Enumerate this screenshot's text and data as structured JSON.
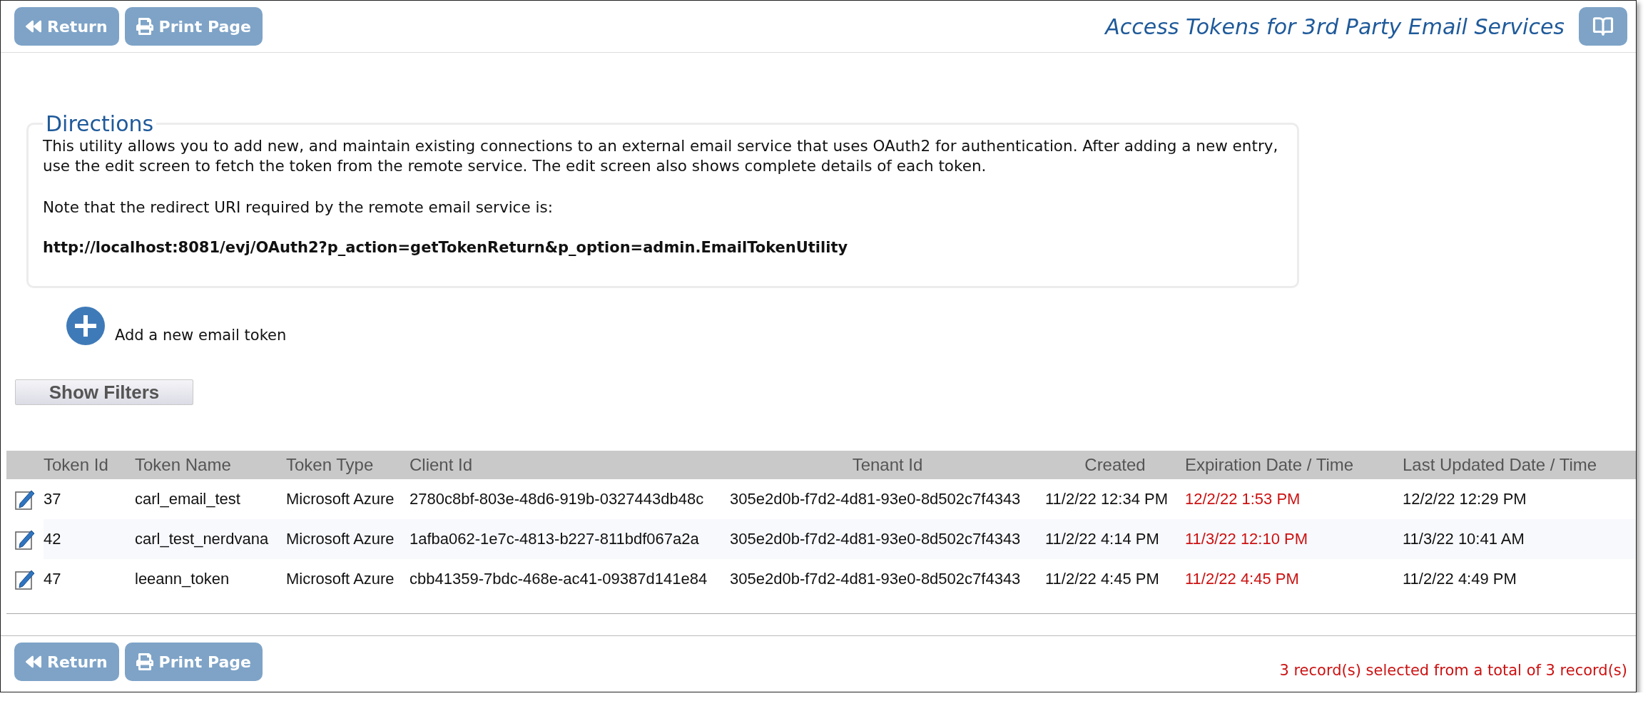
{
  "toolbar": {
    "buttons": [
      {
        "label": "Return",
        "kind": "return"
      },
      {
        "label": "Print Page",
        "kind": "print"
      }
    ],
    "title": "Access Tokens for 3rd Party Email Services"
  },
  "directions": {
    "legend": "Directions",
    "paragraphs": [
      "This utility allows you to add new, and maintain existing connections to an external email service that uses OAuth2 for authentication. After adding a new entry, use the edit screen to fetch the token from the remote service. The edit screen also shows complete details of each token.",
      "Note that the redirect URI required by the remote email service is:"
    ],
    "uri": "http://localhost:8081/evj/OAuth2?p_action=getTokenReturn&p_option=admin.EmailTokenUtility"
  },
  "add_link": "Add a new email token",
  "filter_button": "Show Filters",
  "table": {
    "columns": [
      "Token Id",
      "Token Name",
      "Token Type",
      "Client Id",
      "Tenant Id",
      "Created",
      "Expiration Date / Time",
      "Last Updated Date / Time"
    ],
    "rows": [
      {
        "cells": [
          "37",
          "carl_email_test",
          "Microsoft Azure",
          "2780c8bf-803e-48d6-919b-0327443db48c",
          "305e2d0b-f7d2-4d81-93e0-8d502c7f4343",
          "11/2/22 12:34 PM",
          "12/2/22 1:53 PM",
          "12/2/22 12:29 PM"
        ],
        "expired": true
      },
      {
        "cells": [
          "42",
          "carl_test_nerdvana",
          "Microsoft Azure",
          "1afba062-1e7c-4813-b227-811bdf067a2a",
          "305e2d0b-f7d2-4d81-93e0-8d502c7f4343",
          "11/2/22 4:14 PM",
          "11/3/22 12:10 PM",
          "11/3/22 10:41 AM"
        ],
        "expired": true
      },
      {
        "cells": [
          "47",
          "leeann_token",
          "Microsoft Azure",
          "cbb41359-7bdc-468e-ac41-09387d141e84",
          "305e2d0b-f7d2-4d81-93e0-8d502c7f4343",
          "11/2/22 4:45 PM",
          "11/2/22 4:45 PM",
          "11/2/22 4:49 PM"
        ],
        "expired": true
      }
    ]
  },
  "footer": {
    "buttons": [
      {
        "label": "Return",
        "kind": "return"
      },
      {
        "label": "Print Page",
        "kind": "print"
      }
    ],
    "status": "3 record(s) selected from a total of 3 record(s)"
  }
}
